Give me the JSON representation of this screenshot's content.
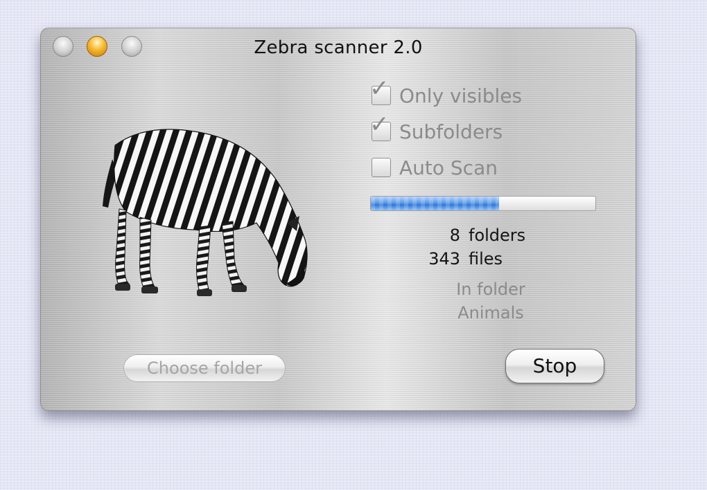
{
  "window": {
    "title": "Zebra scanner 2.0"
  },
  "options": [
    {
      "label": "Only visibles",
      "checked": true
    },
    {
      "label": "Subfolders",
      "checked": true
    },
    {
      "label": "Auto Scan",
      "checked": false
    }
  ],
  "progress": {
    "fraction": 0.57,
    "color": "#3a82e0"
  },
  "counts": {
    "folders_value": "8",
    "folders_label": "folders",
    "files_value": "343",
    "files_label": "files"
  },
  "status": {
    "prefix": "In folder",
    "folder_name": "Animals"
  },
  "buttons": {
    "choose_folder": "Choose folder",
    "stop": "Stop"
  },
  "icons": {
    "checkmark": "✓"
  }
}
